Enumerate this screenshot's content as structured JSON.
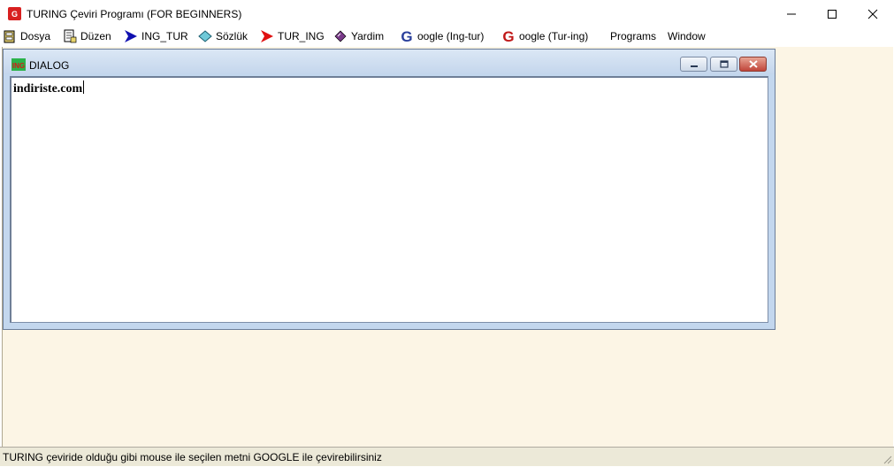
{
  "window": {
    "title": "TURING Çeviri Programı (FOR BEGINNERS)",
    "minimize_glyph": "—",
    "maximize_glyph": "☐",
    "close_glyph": "✕"
  },
  "menu": {
    "items": [
      {
        "label": "Dosya",
        "icon": "file-cabinet-icon"
      },
      {
        "label": "Düzen",
        "icon": "edit-document-icon"
      },
      {
        "label": "ING_TUR",
        "icon": "blue-arrow-icon"
      },
      {
        "label": "Sözlük",
        "icon": "dictionary-diamond-icon"
      },
      {
        "label": "TUR_ING",
        "icon": "red-arrow-icon"
      },
      {
        "label": "Yardim",
        "icon": "book-icon"
      },
      {
        "label": "oogle (Ing-tur)",
        "icon": "google-g-blue-icon"
      },
      {
        "label": "oogle (Tur-ing)",
        "icon": "google-g-red-icon"
      },
      {
        "label": "Programs",
        "icon": ""
      },
      {
        "label": "Window",
        "icon": ""
      }
    ]
  },
  "dialog": {
    "title": "DIALOG",
    "icon_label": "ING",
    "content": "indiriste.com"
  },
  "status": {
    "text": "TURING çeviride olduğu gibi mouse ile seçilen metni GOOGLE ile çevirebilirsiniz"
  },
  "colors": {
    "mdi_background": "#fcf5e5",
    "dialog_frame": "#c3d7ee",
    "status_background": "#ece9d8"
  }
}
